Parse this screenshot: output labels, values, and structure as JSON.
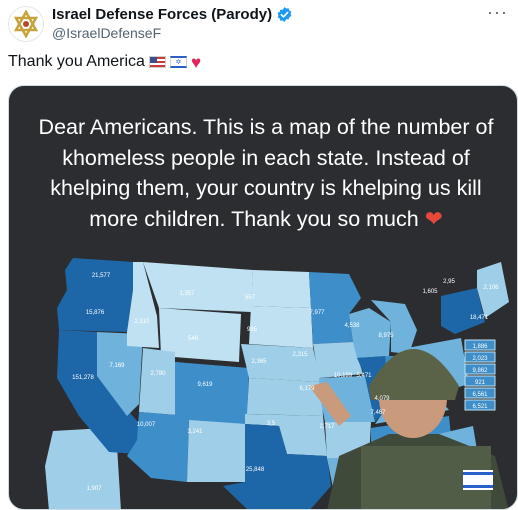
{
  "account": {
    "display_name": "Israel Defense Forces (Parody)",
    "handle": "@IsraelDefenseF",
    "avatar_icon": "star-of-david-icon",
    "verified_icon": "verified-badge-icon",
    "verified_color": "#1d9bf0"
  },
  "menu": {
    "more_label": "···"
  },
  "tweet": {
    "text": "Thank you America",
    "emojis": [
      "us-flag-icon",
      "israel-flag-icon",
      "red-heart-icon"
    ]
  },
  "media": {
    "caption": "Dear Americans. This is a map of the number of khomeless people in each state. Instead of khelping them, your country is khelping us kill more children. Thank you so much",
    "caption_heart": "❤",
    "map_colors": {
      "background": "#2b2d30",
      "light": "#bfe1f2",
      "mid_light": "#9fcfe8",
      "mid": "#6fb3dc",
      "dark": "#3d8ec9",
      "darkest": "#1d67a8"
    },
    "state_values": {
      "Washington": "21,577",
      "Oregon": "15,876",
      "California": "151,278",
      "Nevada": "7,169",
      "Arizona": "10,007",
      "Idaho": "2,310",
      "Montana": "1,357",
      "Wyoming": "546",
      "Utah": "2,780",
      "Colorado": "9,619",
      "New Mexico": "3,241",
      "North Dakota": "557",
      "South Dakota": "985",
      "Nebraska": "2,365",
      "Kansas": "2,315",
      "Minnesota": "7,977",
      "Wisconsin": "4,538",
      "Michigan": "8,975",
      "Illinois": "10,199",
      "Indiana": "5,471",
      "Missouri": "6,179",
      "Kentucky": "4,079",
      "Tennessee": "7,467",
      "Texas": "25,848",
      "Oklahoma": "3,5",
      "Arkansas": "2,717",
      "Alaska": "1,907",
      "Maine": "2,106",
      "New Hampshire": "1,605",
      "Vermont": "2,95",
      "New York": "18,471",
      "East coast small 1": "1,886",
      "East coast small 2": "2,023",
      "East coast small 3": "9,862",
      "East coast small 4": "921",
      "East coast small 5": "6,561",
      "East coast small 6": "6,521"
    }
  }
}
